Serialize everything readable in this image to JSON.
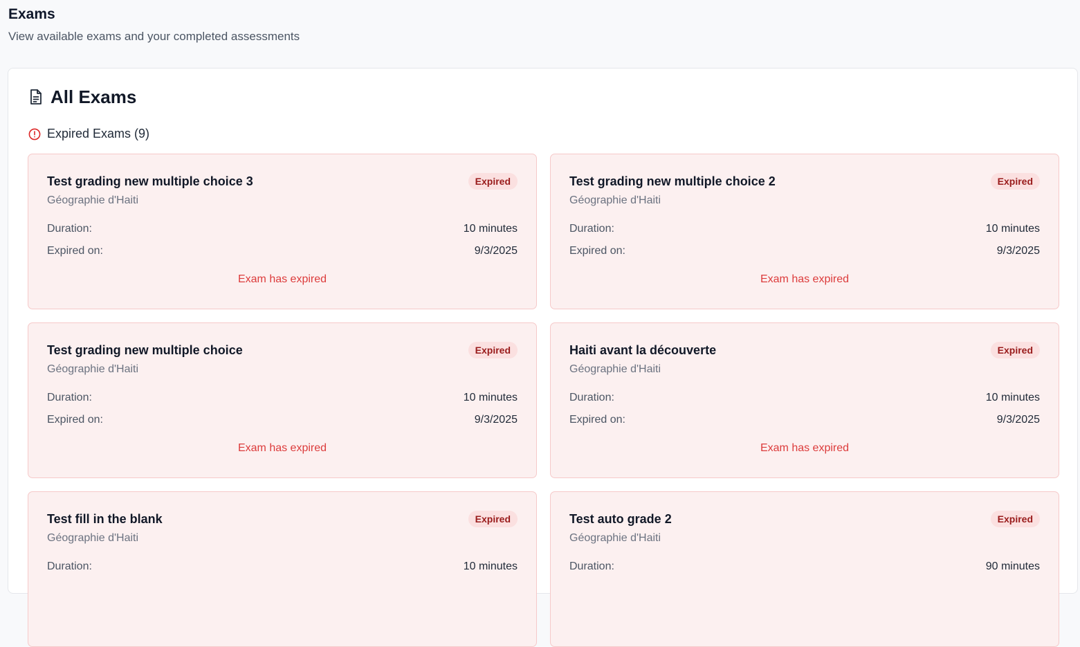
{
  "header": {
    "title": "Exams",
    "subtitle": "View available exams and your completed assessments"
  },
  "panel": {
    "title": "All Exams",
    "title_icon": "document-icon"
  },
  "section": {
    "label": "Expired Exams (9)",
    "icon": "alert-circle-icon"
  },
  "labels": {
    "duration": "Duration:",
    "expired_on": "Expired on:",
    "badge": "Expired",
    "expired_note": "Exam has expired"
  },
  "exams": [
    {
      "title": "Test grading new multiple choice 3",
      "subject": "Géographie d'Haiti",
      "duration": "10 minutes",
      "expired_on": "9/3/2025"
    },
    {
      "title": "Test grading new multiple choice 2",
      "subject": "Géographie d'Haiti",
      "duration": "10 minutes",
      "expired_on": "9/3/2025"
    },
    {
      "title": "Test grading new multiple choice",
      "subject": "Géographie d'Haiti",
      "duration": "10 minutes",
      "expired_on": "9/3/2025"
    },
    {
      "title": "Haiti avant la découverte",
      "subject": "Géographie d'Haiti",
      "duration": "10 minutes",
      "expired_on": "9/3/2025"
    },
    {
      "title": "Test fill in the blank",
      "subject": "Géographie d'Haiti",
      "duration": "10 minutes",
      "expired_on": ""
    },
    {
      "title": "Test auto grade 2",
      "subject": "Géographie d'Haiti",
      "duration": "90 minutes",
      "expired_on": ""
    }
  ],
  "colors": {
    "card_bg": "#fcf0f0",
    "card_border": "#f6c9c9",
    "badge_bg": "#fbe0e0",
    "badge_text": "#991b1b",
    "expired_text": "#dc3b3b"
  }
}
